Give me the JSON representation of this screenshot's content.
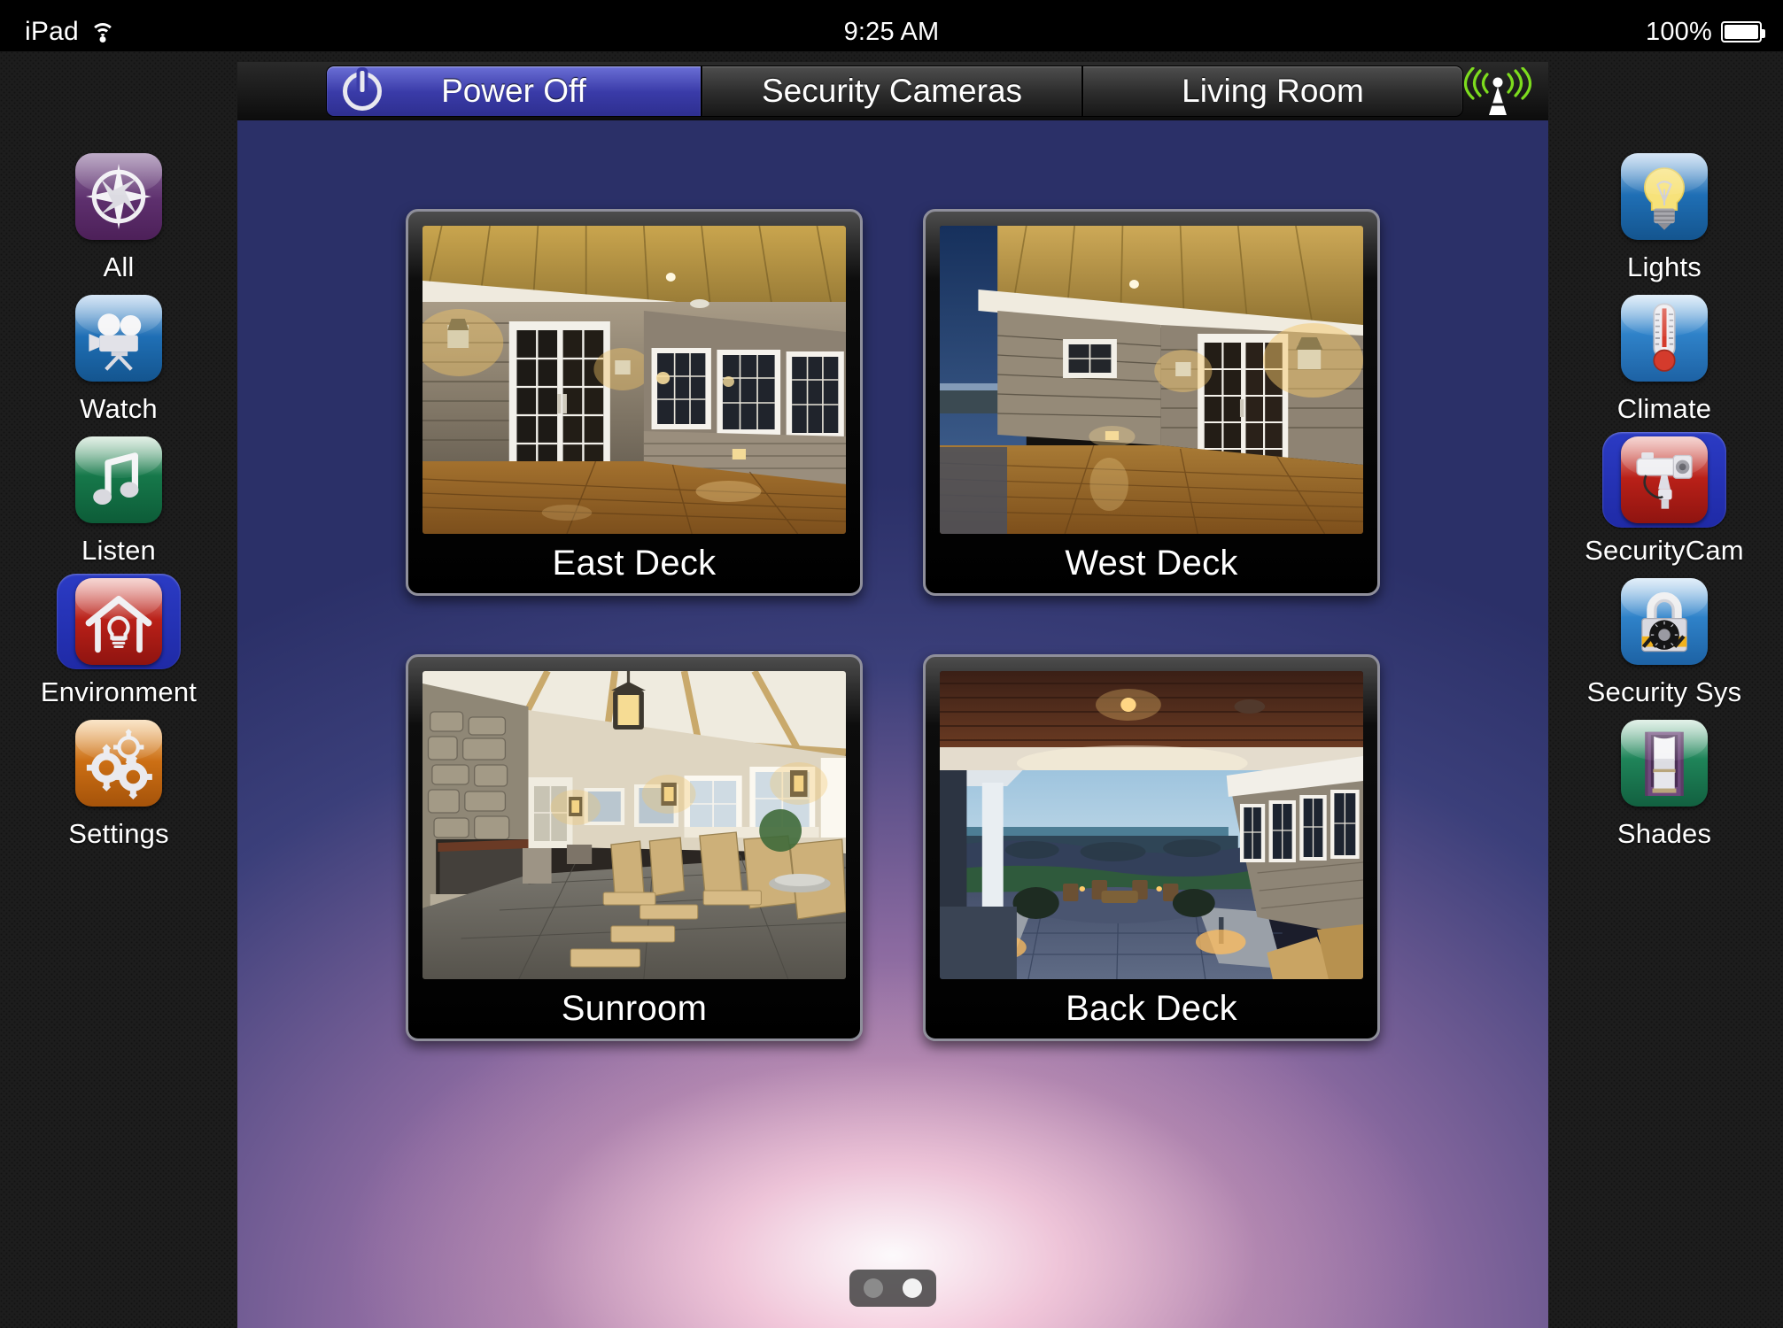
{
  "status_bar": {
    "device_label": "iPad",
    "wifi_icon": "wifi-icon",
    "time": "9:25 AM",
    "battery_percent": "100%",
    "battery_icon": "battery-full-icon"
  },
  "toolbar": {
    "power_off_label": "Power Off",
    "power_icon": "power-icon",
    "security_cameras_label": "Security Cameras",
    "living_room_label": "Living Room",
    "signal_icon": "antenna-signal-icon",
    "active_button": "Power Off"
  },
  "left_rail": {
    "items": [
      {
        "label": "All",
        "icon": "compass-rose-icon",
        "selected": false
      },
      {
        "label": "Watch",
        "icon": "movie-camera-icon",
        "selected": false
      },
      {
        "label": "Listen",
        "icon": "music-note-icon",
        "selected": false
      },
      {
        "label": "Environment",
        "icon": "house-bulb-icon",
        "selected": true
      },
      {
        "label": "Settings",
        "icon": "gears-icon",
        "selected": false
      }
    ]
  },
  "right_rail": {
    "items": [
      {
        "label": "Lights",
        "icon": "lightbulb-icon",
        "selected": false
      },
      {
        "label": "Climate",
        "icon": "thermometer-icon",
        "selected": false
      },
      {
        "label": "SecurityCam",
        "icon": "cctv-camera-icon",
        "selected": true
      },
      {
        "label": "Security Sys",
        "icon": "padlock-icon",
        "selected": false
      },
      {
        "label": "Shades",
        "icon": "window-shade-icon",
        "selected": false
      }
    ]
  },
  "cameras": [
    {
      "name": "East Deck",
      "scene": "covered-porch-french-doors-night"
    },
    {
      "name": "West Deck",
      "scene": "covered-porch-ocean-dusk"
    },
    {
      "name": "Sunroom",
      "scene": "stone-fireplace-rocking-chairs"
    },
    {
      "name": "Back Deck",
      "scene": "patio-ocean-view-dusk"
    }
  ],
  "pager": {
    "total": 2,
    "active_index": 1
  },
  "colors": {
    "accent_blue": "#3a3ba8",
    "selection_blue": "#2b3bc4",
    "signal_green": "#7ddc1e",
    "toolbar_dark": "#2d2d2d"
  }
}
